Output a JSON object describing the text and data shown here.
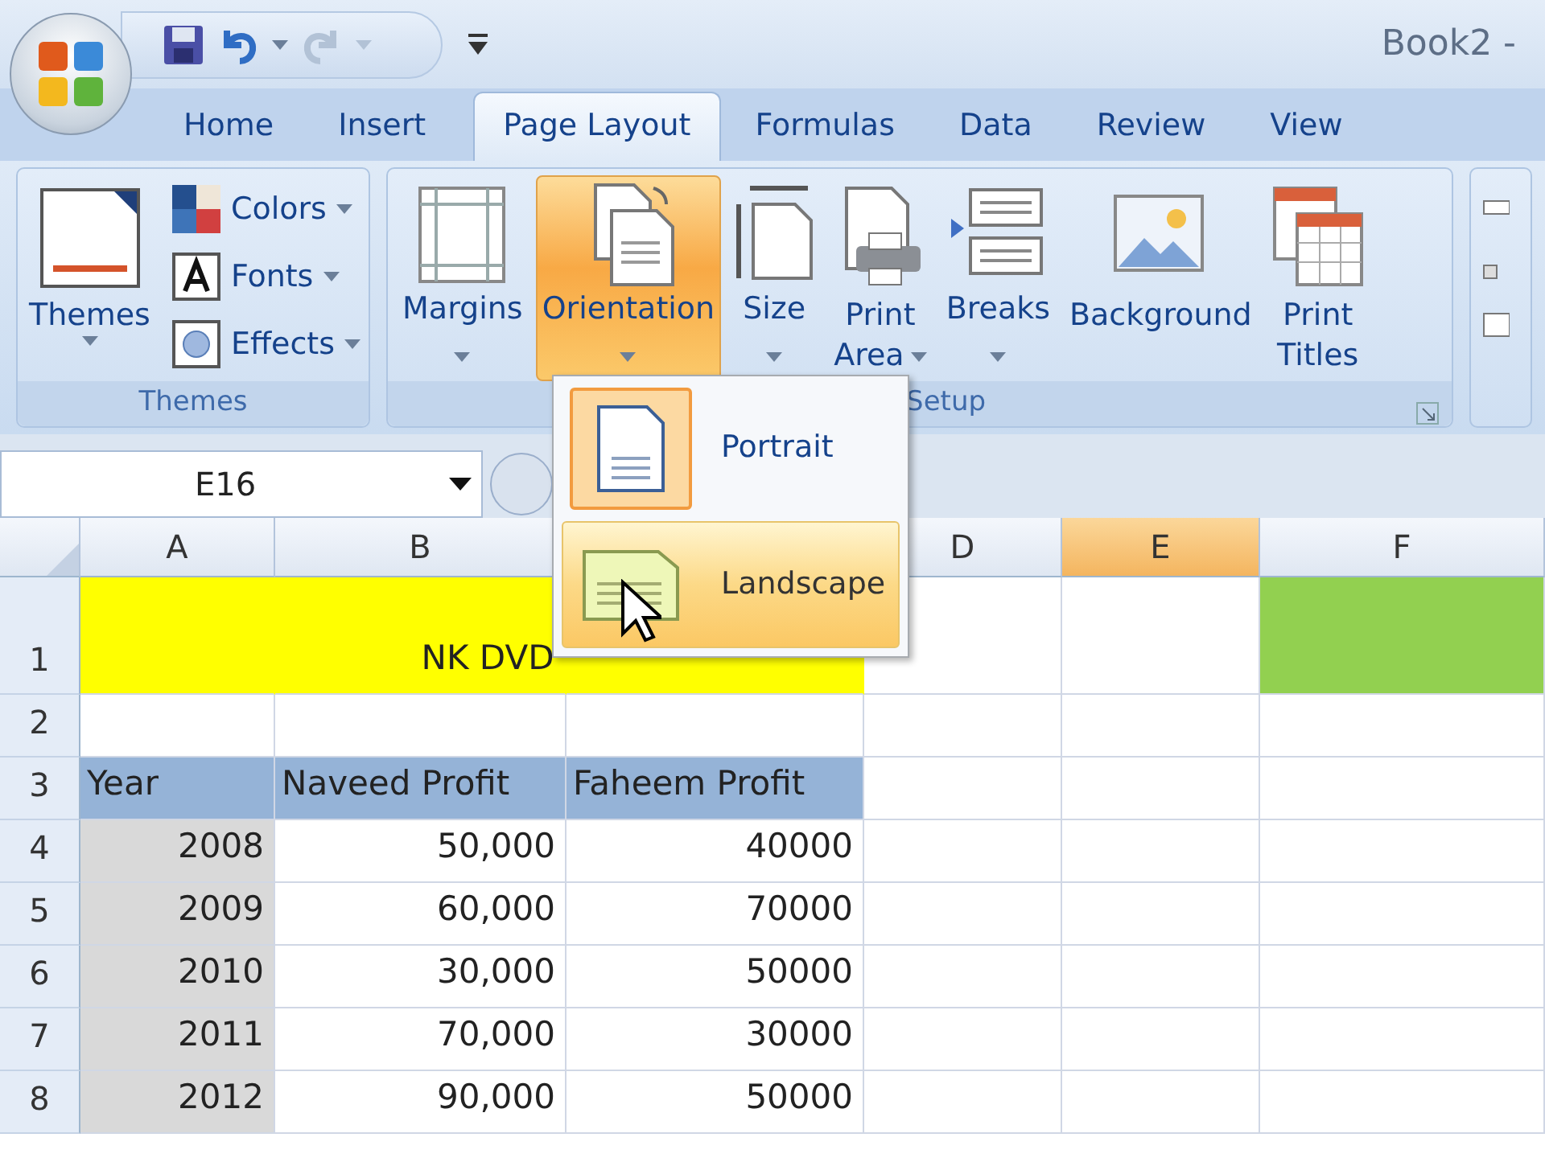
{
  "window": {
    "title": "Book2 -"
  },
  "tabs": [
    {
      "label": "Home",
      "selected": false
    },
    {
      "label": "Insert",
      "selected": false
    },
    {
      "label": "Page Layout",
      "selected": true
    },
    {
      "label": "Formulas",
      "selected": false
    },
    {
      "label": "Data",
      "selected": false
    },
    {
      "label": "Review",
      "selected": false
    },
    {
      "label": "View",
      "selected": false
    }
  ],
  "ribbon": {
    "themes_group": {
      "label": "Themes",
      "big_button": {
        "label": "Themes",
        "menu": true
      },
      "small_buttons": [
        {
          "label": "Colors",
          "menu": true
        },
        {
          "label": "Fonts",
          "menu": true
        },
        {
          "label": "Effects",
          "menu": true
        }
      ]
    },
    "page_setup_group": {
      "label": "Setup",
      "buttons": [
        {
          "lines": [
            "Margins"
          ],
          "menu": true,
          "active": false
        },
        {
          "lines": [
            "Orientation"
          ],
          "menu": true,
          "active": true
        },
        {
          "lines": [
            "Size"
          ],
          "menu": true,
          "active": false
        },
        {
          "lines": [
            "Print",
            "Area"
          ],
          "menu": true,
          "active": false
        },
        {
          "lines": [
            "Breaks"
          ],
          "menu": true,
          "active": false
        },
        {
          "lines": [
            "Background"
          ],
          "menu": false,
          "active": false
        },
        {
          "lines": [
            "Print",
            "Titles"
          ],
          "menu": false,
          "active": false
        }
      ]
    }
  },
  "orientation_menu": {
    "items": [
      {
        "label": "Portrait",
        "selected": true,
        "hovered": false
      },
      {
        "label": "Landscape",
        "selected": false,
        "hovered": true
      }
    ]
  },
  "name_box": {
    "value": "E16"
  },
  "sheet": {
    "columns": [
      {
        "label": "A",
        "selected": false
      },
      {
        "label": "B",
        "selected": false
      },
      {},
      {
        "label": "D",
        "selected": false
      },
      {
        "label": "E",
        "selected": true
      },
      {
        "label": "F",
        "selected": false
      }
    ],
    "rows": [
      {
        "number": "1",
        "cells": [
          {
            "color": "#ffff00",
            "kind": "title"
          },
          {
            "text": "NK DVD",
            "color": "#ffff00",
            "kind": "title"
          },
          {
            "color": "#ffff00",
            "kind": "title"
          },
          {},
          {},
          {
            "color": "#92d050"
          }
        ]
      },
      {
        "number": "2",
        "cells": [
          {},
          {},
          {},
          {},
          {},
          {}
        ]
      },
      {
        "number": "3",
        "cells": [
          {
            "text": "Year",
            "color": "#95b3d7",
            "kind": "text"
          },
          {
            "text": "Naveed Profit",
            "color": "#95b3d7",
            "kind": "text"
          },
          {
            "text": "Faheem Profit",
            "color": "#95b3d7",
            "kind": "text"
          },
          {},
          {},
          {}
        ]
      },
      {
        "number": "4",
        "cells": [
          {
            "text": "2008",
            "color": "#d9d9d9",
            "kind": "number"
          },
          {
            "text": "50,000",
            "kind": "number"
          },
          {
            "text": "40000",
            "kind": "number"
          },
          {},
          {},
          {}
        ]
      },
      {
        "number": "5",
        "cells": [
          {
            "text": "2009",
            "color": "#d9d9d9",
            "kind": "number"
          },
          {
            "text": "60,000",
            "kind": "number"
          },
          {
            "text": "70000",
            "kind": "number"
          },
          {},
          {},
          {}
        ]
      },
      {
        "number": "6",
        "cells": [
          {
            "text": "2010",
            "color": "#d9d9d9",
            "kind": "number"
          },
          {
            "text": "30,000",
            "kind": "number"
          },
          {
            "text": "50000",
            "kind": "number"
          },
          {},
          {},
          {}
        ]
      },
      {
        "number": "7",
        "cells": [
          {
            "text": "2011",
            "color": "#d9d9d9",
            "kind": "number"
          },
          {
            "text": "70,000",
            "kind": "number"
          },
          {
            "text": "30000",
            "kind": "number"
          },
          {},
          {},
          {}
        ]
      },
      {
        "number": "8",
        "cells": [
          {
            "text": "2012",
            "color": "#d9d9d9",
            "kind": "number"
          },
          {
            "text": "90,000",
            "kind": "number"
          },
          {
            "text": "50000",
            "kind": "number"
          },
          {},
          {},
          {}
        ]
      }
    ]
  }
}
